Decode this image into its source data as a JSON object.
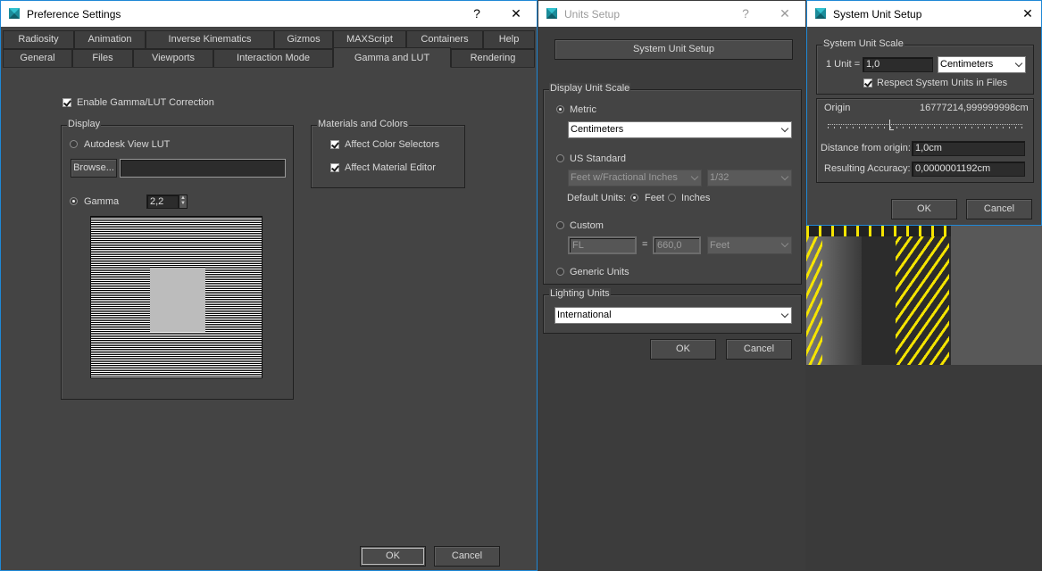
{
  "pref": {
    "title": "Preference Settings",
    "help_glyph": "?",
    "close_glyph": "✕",
    "tabs_row1": [
      "Radiosity",
      "Animation",
      "Inverse Kinematics",
      "Gizmos",
      "MAXScript",
      "Containers",
      "Help"
    ],
    "tabs_row2": [
      "General",
      "Files",
      "Viewports",
      "Interaction Mode",
      "Gamma and LUT",
      "Rendering"
    ],
    "active_tab": "Gamma and LUT",
    "enable_gamma_label": "Enable Gamma/LUT Correction",
    "display_group": "Display",
    "autodesk_lut_label": "Autodesk View LUT",
    "browse_label": "Browse...",
    "browse_path": "",
    "gamma_label": "Gamma",
    "gamma_value": "2,2",
    "materials_group": "Materials and Colors",
    "affect_color_label": "Affect Color Selectors",
    "affect_material_label": "Affect Material Editor",
    "ok_label": "OK",
    "cancel_label": "Cancel"
  },
  "units": {
    "title": "Units Setup",
    "help_glyph": "?",
    "close_glyph": "✕",
    "system_unit_button": "System Unit Setup",
    "display_group": "Display Unit Scale",
    "metric_label": "Metric",
    "metric_value": "Centimeters",
    "us_label": "US Standard",
    "us_value": "Feet w/Fractional Inches",
    "us_fraction": "1/32",
    "default_units_label": "Default Units:",
    "feet_label": "Feet",
    "inches_label": "Inches",
    "custom_label": "Custom",
    "custom_name": "FL",
    "equals": "=",
    "custom_value": "660,0",
    "custom_unit": "Feet",
    "generic_label": "Generic Units",
    "lighting_group": "Lighting Units",
    "lighting_value": "International",
    "ok_label": "OK",
    "cancel_label": "Cancel"
  },
  "system": {
    "title": "System Unit Setup",
    "close_glyph": "✕",
    "scale_group": "System Unit Scale",
    "unit_prefix": "1 Unit =",
    "unit_value": "1,0",
    "unit_type": "Centimeters",
    "respect_label": "Respect System Units in Files",
    "origin_label": "Origin",
    "origin_value": "16777214,999999998cm",
    "distance_label": "Distance from origin:",
    "distance_value": "1,0cm",
    "accuracy_label": "Resulting Accuracy:",
    "accuracy_value": "0,0000001192cm",
    "ok_label": "OK",
    "cancel_label": "Cancel"
  },
  "colors": {
    "accent": "#1f88d6",
    "panel": "#444444",
    "titlebar": "#ffffff",
    "viewport_stripe": "#f5e400"
  }
}
